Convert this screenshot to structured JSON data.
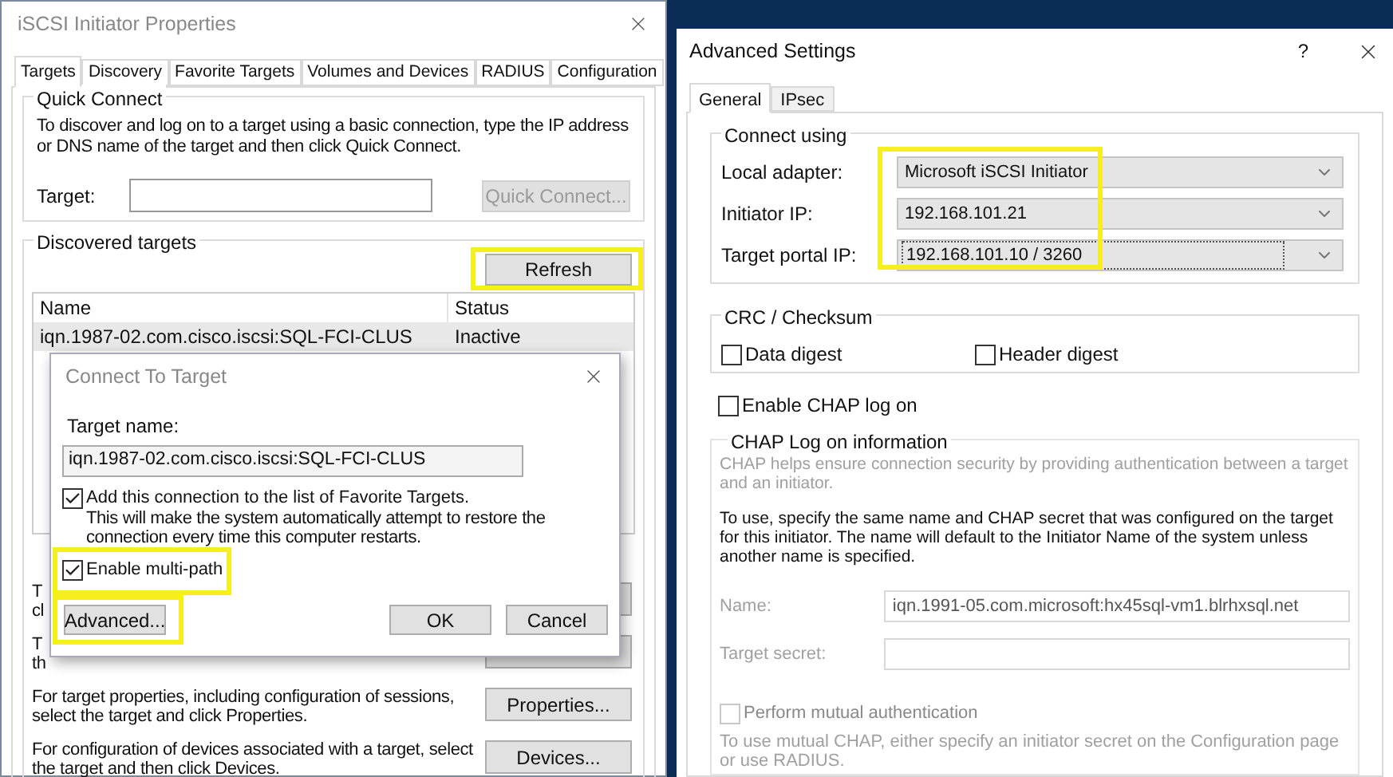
{
  "left_window": {
    "title": "iSCSI Initiator Properties",
    "tabs": [
      {
        "label": "Targets",
        "selected": true
      },
      {
        "label": "Discovery",
        "selected": false
      },
      {
        "label": "Favorite Targets",
        "selected": false
      },
      {
        "label": "Volumes and Devices",
        "selected": false
      },
      {
        "label": "RADIUS",
        "selected": false
      },
      {
        "label": "Configuration",
        "selected": false
      }
    ],
    "quick_connect": {
      "legend": "Quick Connect",
      "description": "To discover and log on to a target using a basic connection, type the IP address or DNS name of the target and then click Quick Connect.",
      "target_label": "Target:",
      "button": {
        "label": "Quick Connect...",
        "disabled": true
      }
    },
    "discovered": {
      "legend": "Discovered targets",
      "refresh": {
        "label": "Refresh",
        "highlighted": true
      },
      "columns": [
        "Name",
        "Status"
      ],
      "rows": [
        {
          "name": "iqn.1987-02.com.cisco.iscsi:SQL-FCI-CLUS",
          "status": "Inactive",
          "selected": true
        }
      ]
    },
    "actions": [
      {
        "lines": [
          "T",
          "cl"
        ]
      },
      {
        "lines": [
          "T",
          "th"
        ]
      },
      {
        "lines": [
          "For target properties, including configuration of sessions,",
          "select the target and click Properties."
        ],
        "button": "Properties..."
      },
      {
        "lines": [
          "For configuration of devices associated with a target, select",
          "the target and then click Devices."
        ],
        "button": "Devices..."
      }
    ]
  },
  "dialog": {
    "title": "Connect To Target",
    "target_name_label": "Target name:",
    "target_name": "iqn.1987-02.com.cisco.iscsi:SQL-FCI-CLUS",
    "options": [
      {
        "label": "Add this connection to the list of Favorite Targets.",
        "note": "This will make the system automatically attempt to restore the connection every time this computer restarts.",
        "checked": true,
        "highlighted": false
      },
      {
        "label": "Enable multi-path",
        "checked": true,
        "highlighted": true
      }
    ],
    "buttons": [
      {
        "label": "Advanced...",
        "highlighted": true
      },
      {
        "label": "OK",
        "highlighted": false
      },
      {
        "label": "Cancel",
        "highlighted": false
      }
    ]
  },
  "right_window": {
    "title": "Advanced Settings",
    "help": "?",
    "tabs": [
      {
        "label": "General",
        "selected": true
      },
      {
        "label": "IPsec",
        "selected": false
      }
    ],
    "connect_using": {
      "legend": "Connect using",
      "highlighted": true,
      "fields": [
        {
          "label": "Local adapter:",
          "value": "Microsoft iSCSI Initiator",
          "focused": false
        },
        {
          "label": "Initiator IP:",
          "value": "192.168.101.21",
          "focused": false
        },
        {
          "label": "Target portal IP:",
          "value": "192.168.101.10 / 3260",
          "focused": true
        }
      ]
    },
    "crc": {
      "legend": "CRC / Checksum",
      "options": [
        {
          "label": "Data digest",
          "checked": false
        },
        {
          "label": "Header digest",
          "checked": false
        }
      ]
    },
    "chap_enable": {
      "label": "Enable CHAP log on",
      "checked": false
    },
    "chap": {
      "legend": "CHAP Log on information",
      "disabled": true,
      "info": "CHAP helps ensure connection security by providing authentication between a target and an initiator.",
      "instructions": "To use, specify the same name and CHAP secret that was configured on the target for this initiator.  The name will default to the Initiator Name of the system unless another name is specified.",
      "fields": [
        {
          "label": "Name:",
          "value": "iqn.1991-05.com.microsoft:hx45sql-vm1.blrhxsql.net"
        },
        {
          "label": "Target secret:"
        }
      ],
      "mutual": {
        "label": "Perform mutual authentication",
        "checked": false
      },
      "mutual_note": "To use mutual CHAP, either specify an initiator secret on the Configuration page or use RADIUS."
    }
  }
}
